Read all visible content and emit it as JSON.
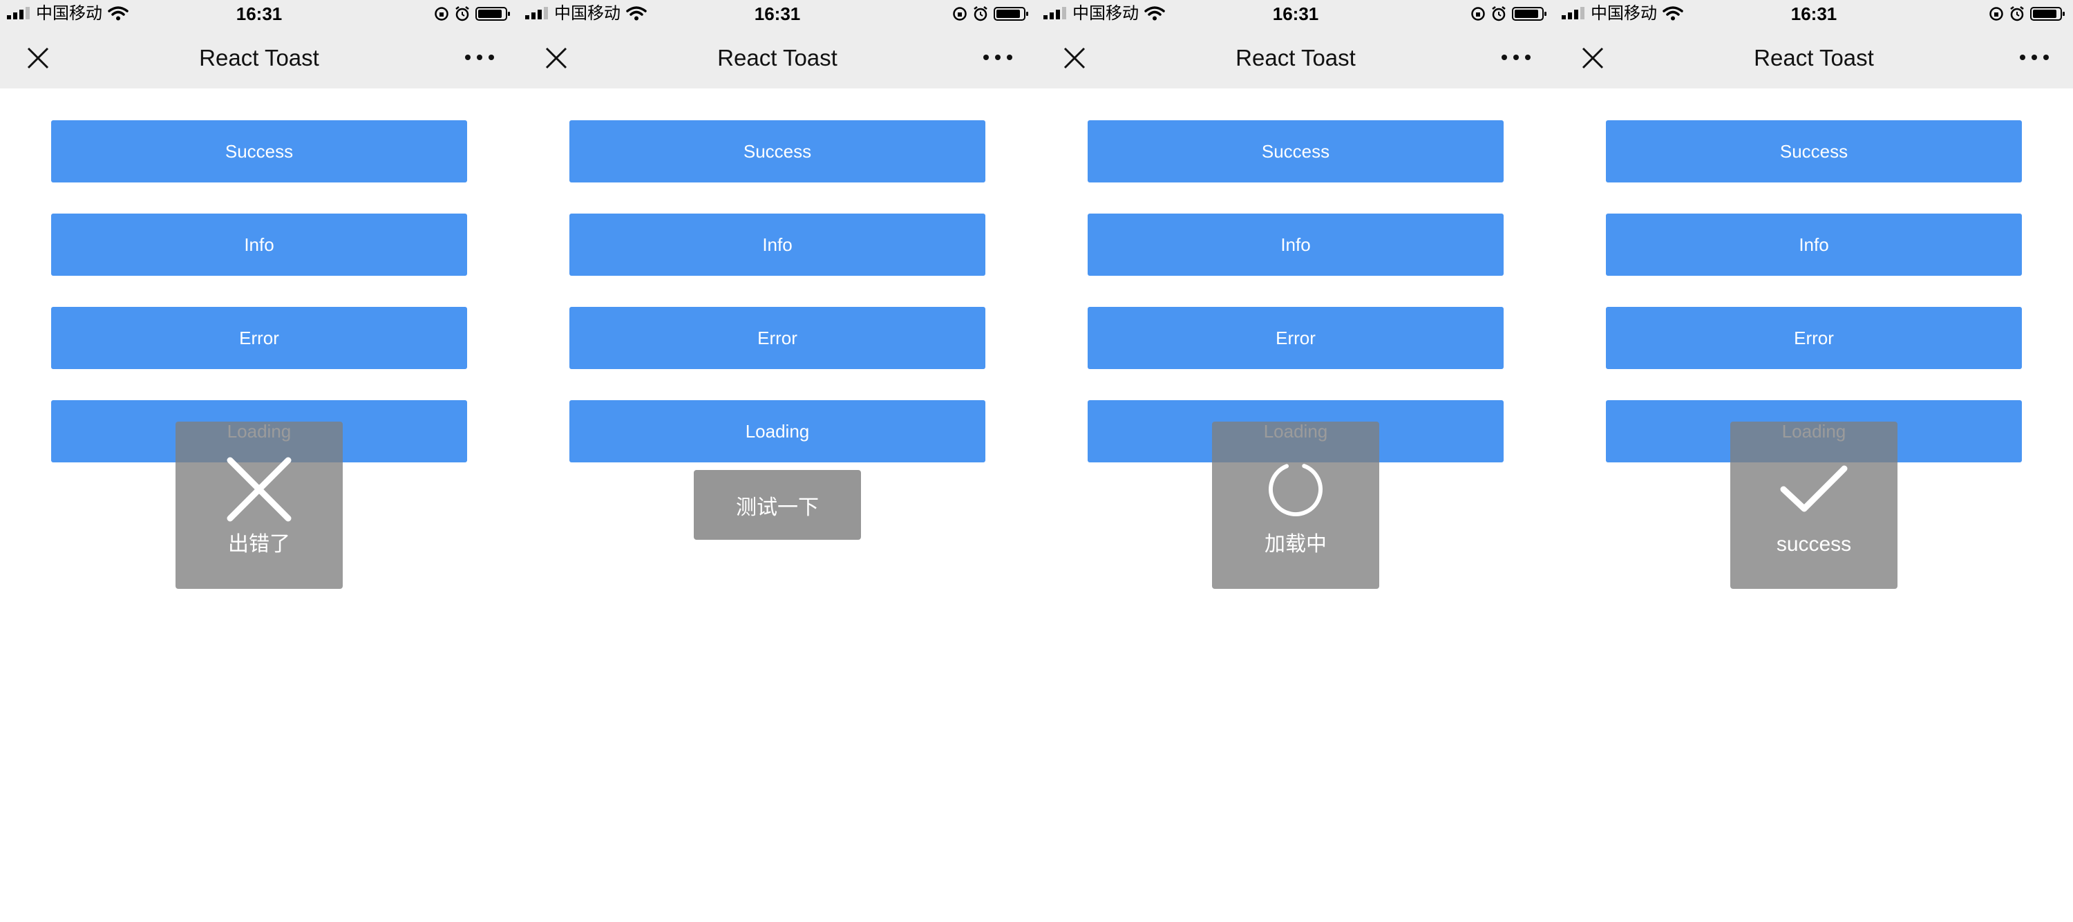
{
  "status_bar": {
    "carrier": "中国移动",
    "time": "16:31",
    "icons": [
      "signal-icon",
      "wifi-icon",
      "orientation-lock-icon",
      "alarm-icon",
      "battery-icon"
    ]
  },
  "nav": {
    "title": "React Toast",
    "close_icon": "close-icon",
    "more_icon": "more-icon"
  },
  "buttons": {
    "success": "Success",
    "info": "Info",
    "error": "Error",
    "loading": "Loading"
  },
  "colors": {
    "button_blue": "#4a95f2",
    "toast_bg": "#7f7f7f",
    "bar_bg": "#ededed"
  },
  "screens": [
    {
      "toast": {
        "type": "error",
        "icon": "x-icon",
        "text": "出错了"
      }
    },
    {
      "toast": {
        "type": "info",
        "text": "测试一下"
      }
    },
    {
      "toast": {
        "type": "loading",
        "icon": "spinner-icon",
        "text": "加载中"
      }
    },
    {
      "toast": {
        "type": "success",
        "icon": "checkmark-icon",
        "text": "success"
      }
    }
  ]
}
